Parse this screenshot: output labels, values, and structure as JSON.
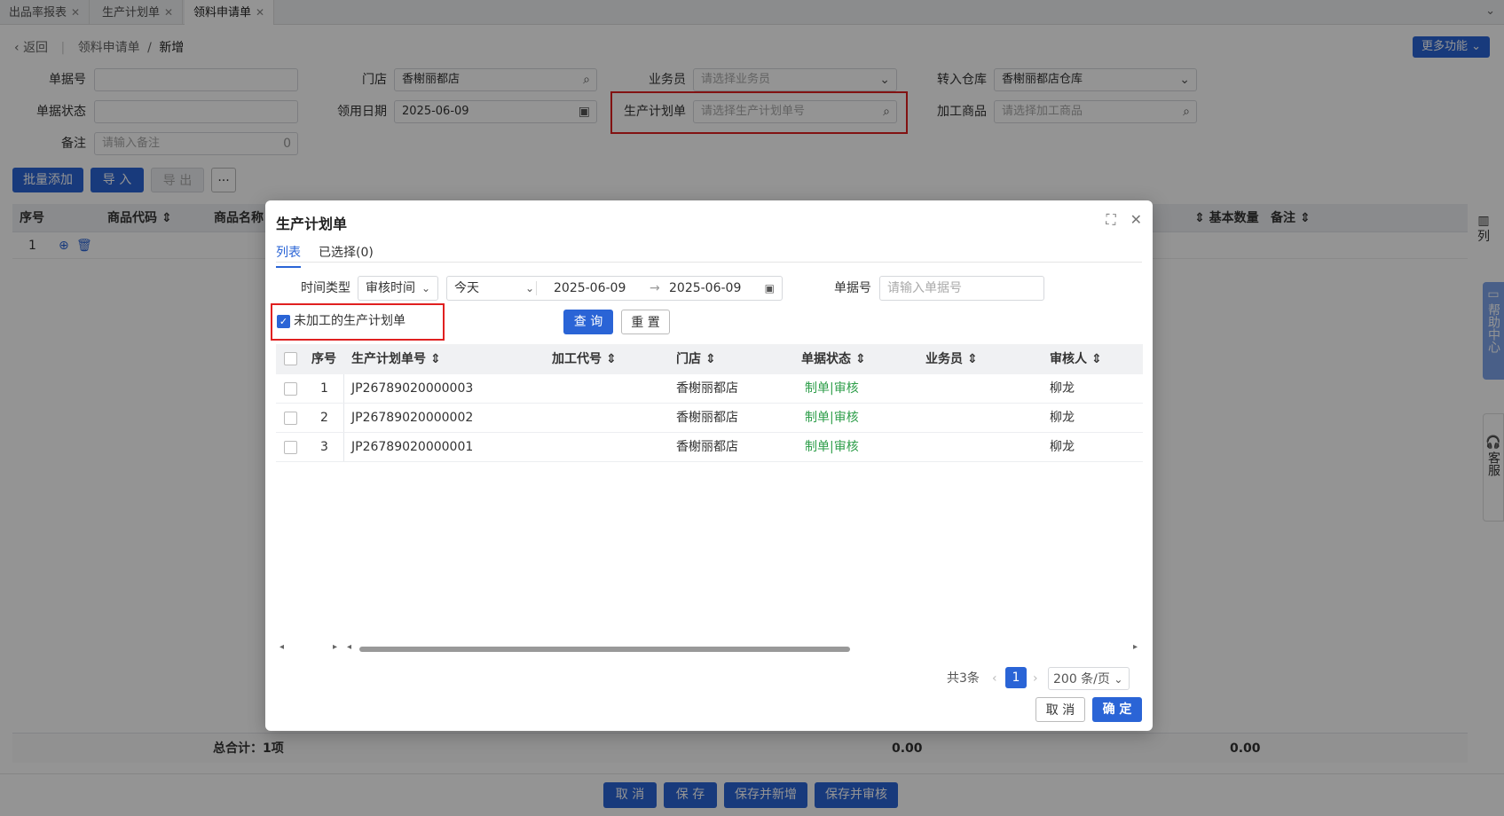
{
  "tabs": [
    {
      "label": "出品率报表"
    },
    {
      "label": "生产计划单"
    },
    {
      "label": "领料申请单"
    }
  ],
  "breadcrumb": {
    "back": "返回",
    "parent": "领料申请单",
    "current": "新增"
  },
  "more_button": "更多功能",
  "form": {
    "doc_no": {
      "label": "单据号",
      "value": ""
    },
    "doc_status": {
      "label": "单据状态",
      "value": ""
    },
    "remark": {
      "label": "备注",
      "placeholder": "请输入备注",
      "count": "0"
    },
    "store": {
      "label": "门店",
      "value": "香榭丽都店"
    },
    "use_date": {
      "label": "领用日期",
      "value": "2025-06-09"
    },
    "salesman": {
      "label": "业务员",
      "placeholder": "请选择业务员"
    },
    "plan": {
      "label": "生产计划单",
      "placeholder": "请选择生产计划单号"
    },
    "warehouse": {
      "label": "转入仓库",
      "value": "香榭丽都店仓库"
    },
    "product": {
      "label": "加工商品",
      "placeholder": "请选择加工商品"
    }
  },
  "toolbar": {
    "batch_add": "批量添加",
    "import": "导 入",
    "export": "导 出",
    "more": "···"
  },
  "grid": {
    "headers": {
      "seq": "序号",
      "code": "商品代码",
      "name": "商品名称",
      "base_qty": "基本数量",
      "remark": "备注"
    },
    "row_seq": "1",
    "footer": {
      "total_label": "总合计：1项",
      "total1": "0.00",
      "total2": "0.00"
    },
    "col_handle": "列"
  },
  "side": {
    "help": "帮助中心",
    "service": "客服"
  },
  "bottom": {
    "cancel": "取 消",
    "save": "保 存",
    "save_new": "保存并新增",
    "save_audit": "保存并审核"
  },
  "dialog": {
    "title": "生产计划单",
    "tabs": {
      "list": "列表",
      "selected": "已选择(0)"
    },
    "filters": {
      "time_type_label": "时间类型",
      "time_type_value": "审核时间",
      "range_value": "今天",
      "date_from": "2025-06-09",
      "date_to": "2025-06-09",
      "doc_no_label": "单据号",
      "doc_no_placeholder": "请输入单据号",
      "unprocessed_label": "未加工的生产计划单",
      "query": "查 询",
      "reset": "重 置"
    },
    "columns": {
      "seq": "序号",
      "plan_no": "生产计划单号",
      "process_code": "加工代号",
      "store": "门店",
      "status": "单据状态",
      "salesman": "业务员",
      "auditor": "审核人"
    },
    "rows": [
      {
        "seq": "1",
        "plan_no": "JP26789020000003",
        "process_code": "",
        "store": "香榭丽都店",
        "status": "制单|审核",
        "salesman": "",
        "auditor": "柳龙"
      },
      {
        "seq": "2",
        "plan_no": "JP26789020000002",
        "process_code": "",
        "store": "香榭丽都店",
        "status": "制单|审核",
        "salesman": "",
        "auditor": "柳龙"
      },
      {
        "seq": "3",
        "plan_no": "JP26789020000001",
        "process_code": "",
        "store": "香榭丽都店",
        "status": "制单|审核",
        "salesman": "",
        "auditor": "柳龙"
      }
    ],
    "pager": {
      "total": "共3条",
      "page": "1",
      "page_size": "200 条/页"
    },
    "cancel": "取 消",
    "confirm": "确 定"
  },
  "colors": {
    "primary": "#2a64d6",
    "status_green": "#2e9e4a",
    "highlight_red": "#e02020"
  }
}
